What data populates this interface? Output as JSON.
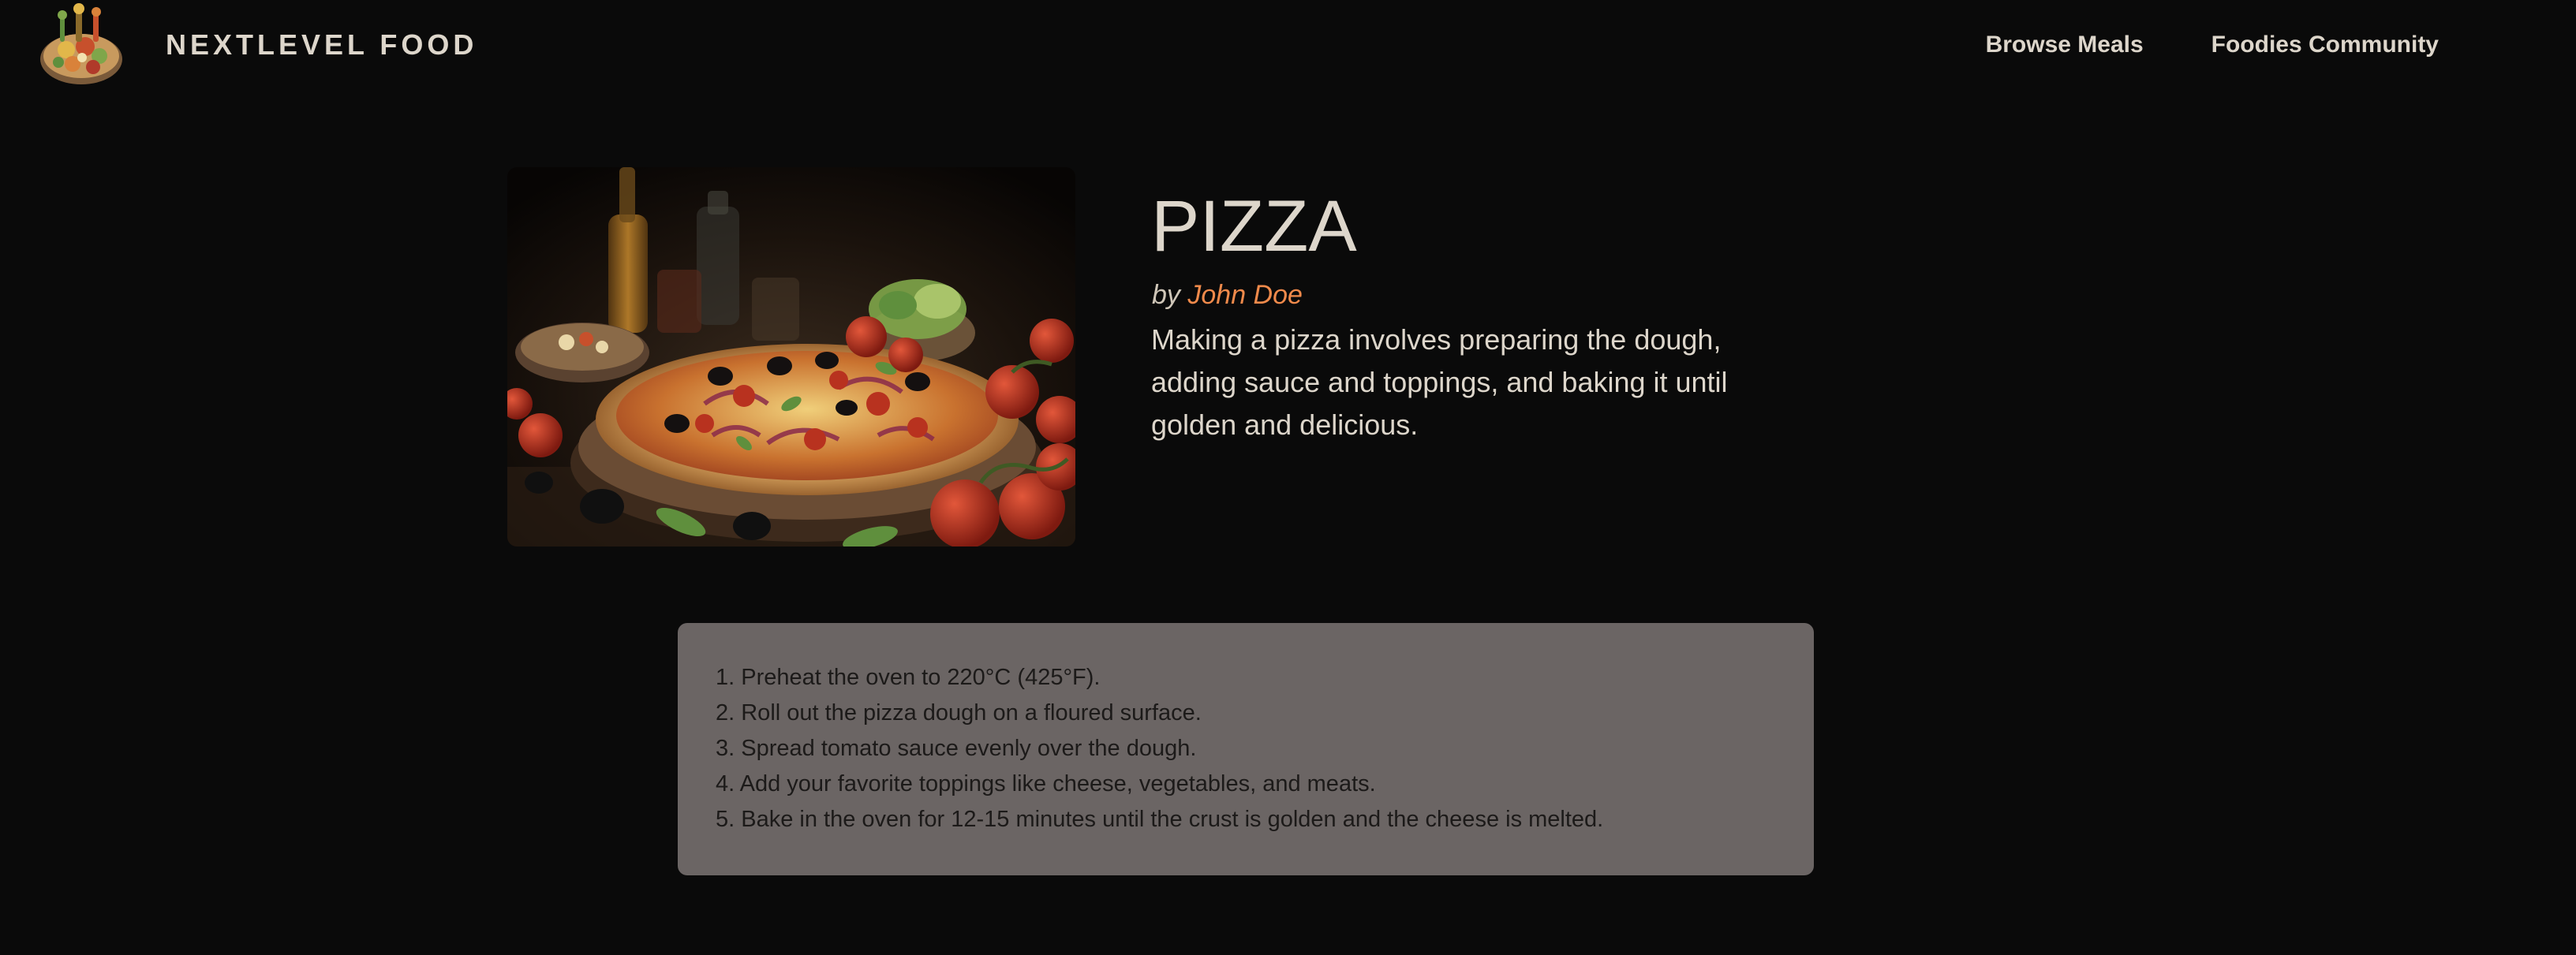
{
  "header": {
    "logo_text": "NEXTLEVEL FOOD",
    "nav": [
      {
        "label": "Browse Meals"
      },
      {
        "label": "Foodies Community"
      }
    ]
  },
  "meal": {
    "title": "PIZZA",
    "by_label": "by",
    "creator": "John Doe",
    "summary": "Making a pizza involves preparing the dough, adding sauce and toppings, and baking it until golden and delicious.",
    "instructions": [
      "1. Preheat the oven to 220°C (425°F).",
      "2. Roll out the pizza dough on a floured surface.",
      "3. Spread tomato sauce evenly over the dough.",
      "4. Add your favorite toppings like cheese, vegetables, and meats.",
      "5. Bake in the oven for 12-15 minutes until the crust is golden and the cheese is melted."
    ]
  },
  "colors": {
    "background": "#0a0a0a",
    "text": "#ddd6cb",
    "accent": "#f08a4b",
    "instructions_bg": "#6b6564"
  }
}
